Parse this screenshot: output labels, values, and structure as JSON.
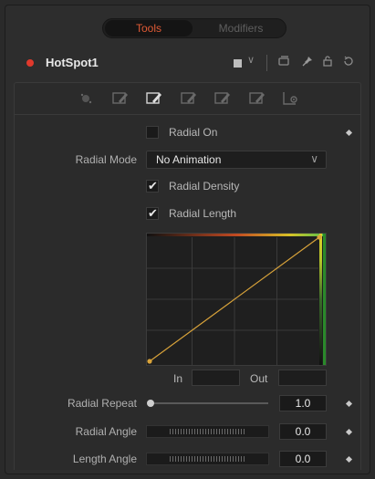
{
  "tabs": [
    {
      "label": "Tools",
      "active": true
    },
    {
      "label": "Modifiers",
      "active": false
    }
  ],
  "tool": {
    "name": "HotSpot1",
    "status_color": "#e0392c"
  },
  "header_icons": [
    "color-swatch-icon",
    "chevron-down-icon",
    "window-icon",
    "pin-icon",
    "lock-icon",
    "reset-icon"
  ],
  "subtabs": [
    {
      "icon": "primary-element-icon",
      "active": false
    },
    {
      "icon": "secondary-element-icon",
      "active": false
    },
    {
      "icon": "radial-page-icon",
      "active": true
    },
    {
      "icon": "stretch-page-icon",
      "active": false
    },
    {
      "icon": "lens-page-icon",
      "active": false
    },
    {
      "icon": "custom-page-icon",
      "active": false
    },
    {
      "icon": "settings-page-icon",
      "active": false
    }
  ],
  "controls": {
    "radial_on": {
      "label": "Radial On",
      "checked": false
    },
    "radial_mode": {
      "label": "Radial Mode",
      "value": "No Animation"
    },
    "radial_density": {
      "label": "Radial Density",
      "checked": true
    },
    "radial_length": {
      "label": "Radial Length",
      "checked": true
    },
    "curve": {
      "in_label": "In",
      "out_label": "Out",
      "in_value": "",
      "out_value": "",
      "points": [
        [
          0,
          0
        ],
        [
          1,
          1
        ]
      ]
    },
    "radial_repeat": {
      "label": "Radial Repeat",
      "value": "1.0"
    },
    "radial_angle": {
      "label": "Radial Angle",
      "value": "0.0"
    },
    "length_angle": {
      "label": "Length Angle",
      "value": "0.0"
    }
  },
  "colors": {
    "accent": "#e05a35",
    "curve_line": "#d9a33a",
    "gradient_red": "#d03a2a",
    "gradient_yellow": "#e8d028",
    "gradient_green": "#4ec04a"
  }
}
